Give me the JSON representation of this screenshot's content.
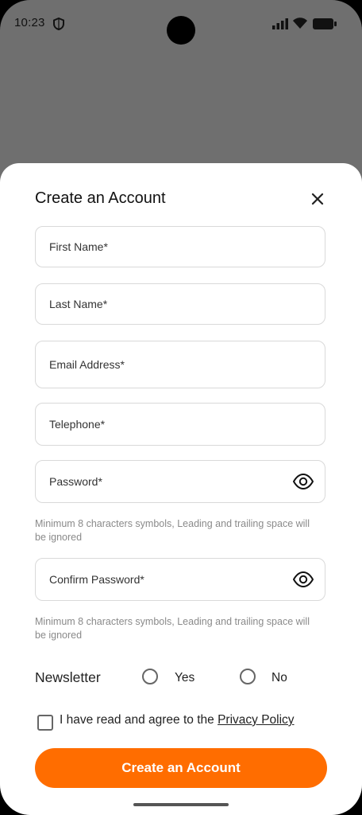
{
  "status_bar": {
    "time": "10:23"
  },
  "form": {
    "title": "Create an Account",
    "fields": [
      {
        "placeholder": "First Name*"
      },
      {
        "placeholder": "Last Name*"
      },
      {
        "placeholder": "Email Address*"
      },
      {
        "placeholder": "Telephone*"
      },
      {
        "placeholder": "Password*"
      },
      {
        "placeholder": "Confirm Password*"
      }
    ],
    "password_hint": "Minimum 8 characters symbols, Leading and trailing space will be ignored",
    "confirm_hint": "Minimum 8 characters symbols, Leading and trailing space will be ignored",
    "newsletter": {
      "label": "Newsletter",
      "yes": "Yes",
      "no": "No"
    },
    "agree_text": "I have read and agree to the ",
    "privacy_link": "Privacy Policy",
    "submit_label": "Create an Account"
  },
  "colors": {
    "accent": "#ff6d00",
    "backdrop": "#6f6f6f"
  }
}
